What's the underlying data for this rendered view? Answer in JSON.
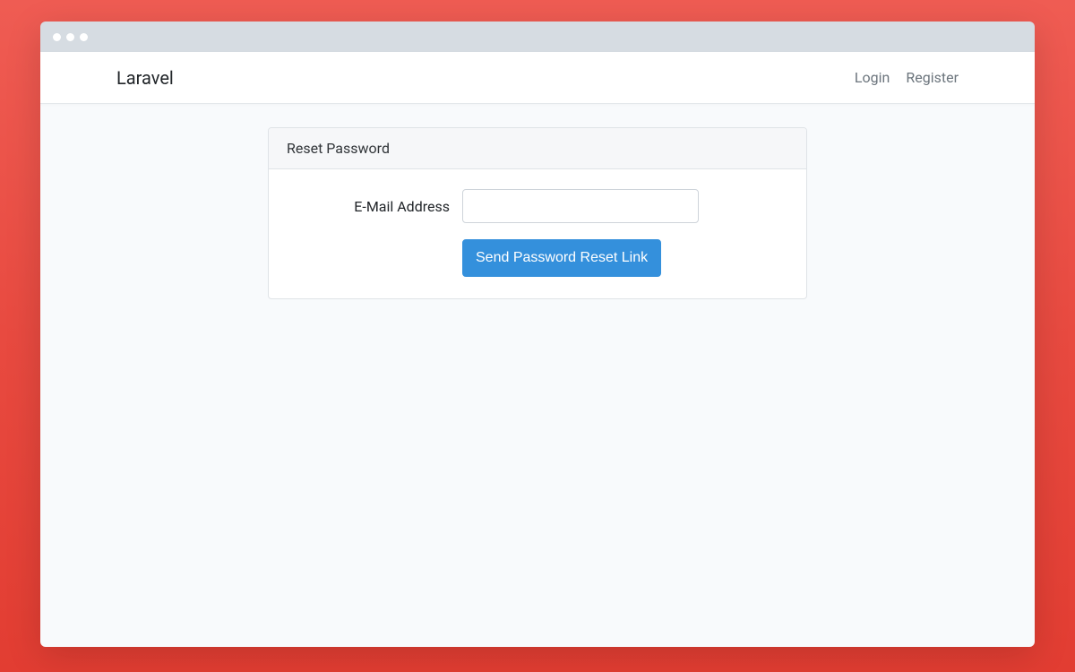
{
  "navbar": {
    "brand": "Laravel",
    "links": {
      "login": "Login",
      "register": "Register"
    }
  },
  "card": {
    "title": "Reset Password",
    "form": {
      "email_label": "E-Mail Address",
      "email_value": "",
      "submit_label": "Send Password Reset Link"
    }
  }
}
